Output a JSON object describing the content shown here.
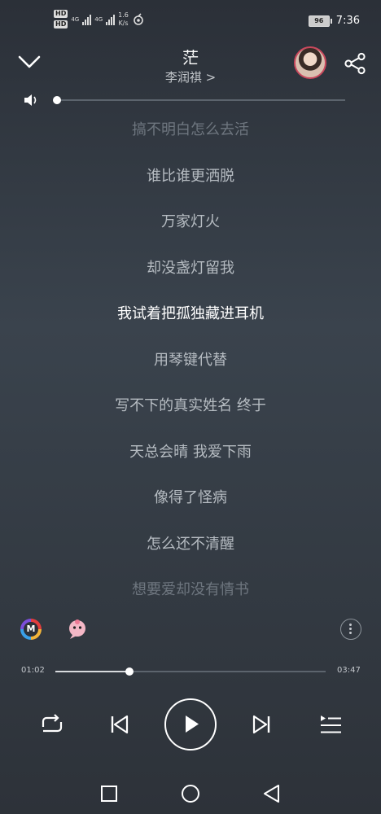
{
  "status_bar": {
    "hd1": "HD",
    "hd2": "HD",
    "net1": "4G",
    "net2": "4G",
    "speed_value": "1.6",
    "speed_unit": "K/s",
    "battery": "96",
    "time": "7:36"
  },
  "song": {
    "title": "茫",
    "artist": "李润祺 >"
  },
  "volume": {
    "level": 0.0
  },
  "lyrics": [
    {
      "text": "搞不明白怎么去活",
      "state": "faded"
    },
    {
      "text": "谁比谁更洒脱",
      "state": "normal"
    },
    {
      "text": "万家灯火",
      "state": "normal"
    },
    {
      "text": "却没盏灯留我",
      "state": "normal"
    },
    {
      "text": "我试着把孤独藏进耳机",
      "state": "current"
    },
    {
      "text": "用琴键代替",
      "state": "normal"
    },
    {
      "text": "写不下的真实姓名 终于",
      "state": "normal"
    },
    {
      "text": "天总会晴 我爱下雨",
      "state": "normal"
    },
    {
      "text": "像得了怪病",
      "state": "normal"
    },
    {
      "text": "怎么还不清醒",
      "state": "normal"
    },
    {
      "text": "想要爱却没有情书",
      "state": "faded"
    }
  ],
  "source_badge": {
    "letter": "M"
  },
  "progress": {
    "elapsed": "01:02",
    "total": "03:47",
    "fraction": 0.273
  },
  "icons": {
    "collapse": "chevron-down-icon",
    "share": "share-icon",
    "volume": "volume-icon",
    "repeat": "repeat-icon",
    "previous": "previous-icon",
    "play": "play-icon",
    "next": "next-icon",
    "playlist": "playlist-icon",
    "more": "more-icon",
    "nav_recent": "square-icon",
    "nav_home": "circle-icon",
    "nav_back": "triangle-back-icon"
  },
  "colors": {
    "avatar_ring": "#c9485d",
    "accent": "#ffffff"
  }
}
